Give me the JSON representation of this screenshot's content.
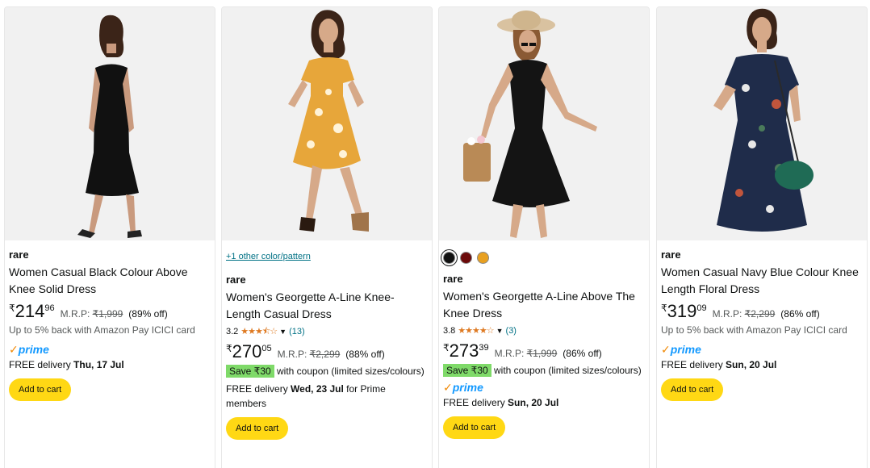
{
  "cards": [
    {
      "brand": "rare",
      "title": "Women Casual Black Colour Above Knee Solid Dress",
      "currency": "₹",
      "price_whole": "214",
      "price_frac": "96",
      "mrp_label": "M.R.P:",
      "mrp": "₹1,999",
      "off": "(89% off)",
      "cashback": "Up to 5% back with Amazon Pay ICICI card",
      "prime_word": "prime",
      "delivery_prefix": "FREE delivery ",
      "delivery_date": "Thu, 17 Jul",
      "cart_label": "Add to cart"
    },
    {
      "other_color": "+1 other color/pattern",
      "brand": "rare",
      "title": "Women's Georgette A-Line Knee-Length Casual Dress",
      "rating": "3.2",
      "stars": "★★★⯪☆",
      "rating_count": "(13)",
      "currency": "₹",
      "price_whole": "270",
      "price_frac": "05",
      "mrp_label": "M.R.P:",
      "mrp": "₹2,299",
      "off": "(88% off)",
      "save": "Save ₹30",
      "coupon_text": " with coupon (limited sizes/colours)",
      "delivery_prefix": "FREE delivery ",
      "delivery_date": "Wed, 23 Jul",
      "delivery_suffix": " for Prime members",
      "cart_label": "Add to cart"
    },
    {
      "swatch_colors": [
        "#111111",
        "#6b0a0a",
        "#e8a020"
      ],
      "brand": "rare",
      "title": "Women's Georgette A-Line Above The Knee Dress",
      "rating": "3.8",
      "stars": "★★★★☆",
      "rating_count": "(3)",
      "currency": "₹",
      "price_whole": "273",
      "price_frac": "39",
      "mrp_label": "M.R.P:",
      "mrp": "₹1,999",
      "off": "(86% off)",
      "save": "Save ₹30",
      "coupon_text": " with coupon (limited sizes/colours)",
      "prime_word": "prime",
      "delivery_prefix": "FREE delivery ",
      "delivery_date": "Sun, 20 Jul",
      "cart_label": "Add to cart"
    },
    {
      "brand": "rare",
      "title": "Women Casual Navy Blue Colour Knee Length Floral Dress",
      "currency": "₹",
      "price_whole": "319",
      "price_frac": "09",
      "mrp_label": "M.R.P:",
      "mrp": "₹2,299",
      "off": "(86% off)",
      "cashback": "Up to 5% back with Amazon Pay ICICI card",
      "prime_word": "prime",
      "delivery_prefix": "FREE delivery ",
      "delivery_date": "Sun, 20 Jul",
      "cart_label": "Add to cart"
    }
  ],
  "colors": {
    "cart_button": "#ffd814",
    "save_badge": "#7fda69",
    "prime_blue": "#1399ff",
    "prime_check": "#f08804",
    "star": "#de7921",
    "link": "#007185"
  }
}
